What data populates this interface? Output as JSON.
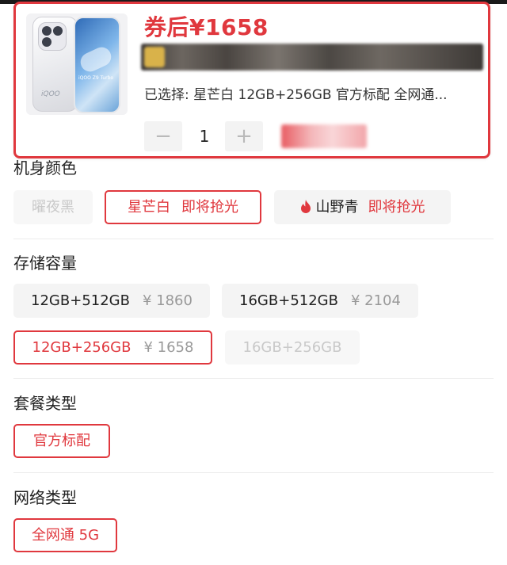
{
  "product": {
    "price": "券后¥1658",
    "selected": "已选择: 星芒白 12GB+256GB 官方标配 全网通...",
    "quantity": "1",
    "qty_minus": "−",
    "qty_plus": "+",
    "phone_brand_text": "iQOO",
    "screen_text": "iQOO Z9 Turbo"
  },
  "color": {
    "title": "机身颜色",
    "options": [
      {
        "label": "曜夜黑",
        "state": "disabled"
      },
      {
        "label": "星芒白",
        "note": "即将抢光",
        "state": "selected"
      },
      {
        "label": "山野青",
        "note": "即将抢光",
        "state": "normal",
        "icon": "flame-icon"
      }
    ]
  },
  "storage": {
    "title": "存储容量",
    "options": [
      {
        "label": "12GB+512GB",
        "price": "¥ 1860",
        "state": "normal"
      },
      {
        "label": "16GB+512GB",
        "price": "¥ 2104",
        "state": "normal"
      },
      {
        "label": "12GB+256GB",
        "price": "¥ 1658",
        "state": "selected"
      },
      {
        "label": "16GB+256GB",
        "state": "disabled"
      }
    ]
  },
  "package": {
    "title": "套餐类型",
    "options": [
      {
        "label": "官方标配",
        "state": "selected"
      }
    ]
  },
  "network": {
    "title": "网络类型",
    "options": [
      {
        "label": "全网通 5G",
        "state": "selected"
      }
    ]
  },
  "colors": {
    "accent": "#e0383e",
    "option_bg": "#f4f4f4",
    "disabled_text": "#c9c9c9"
  }
}
